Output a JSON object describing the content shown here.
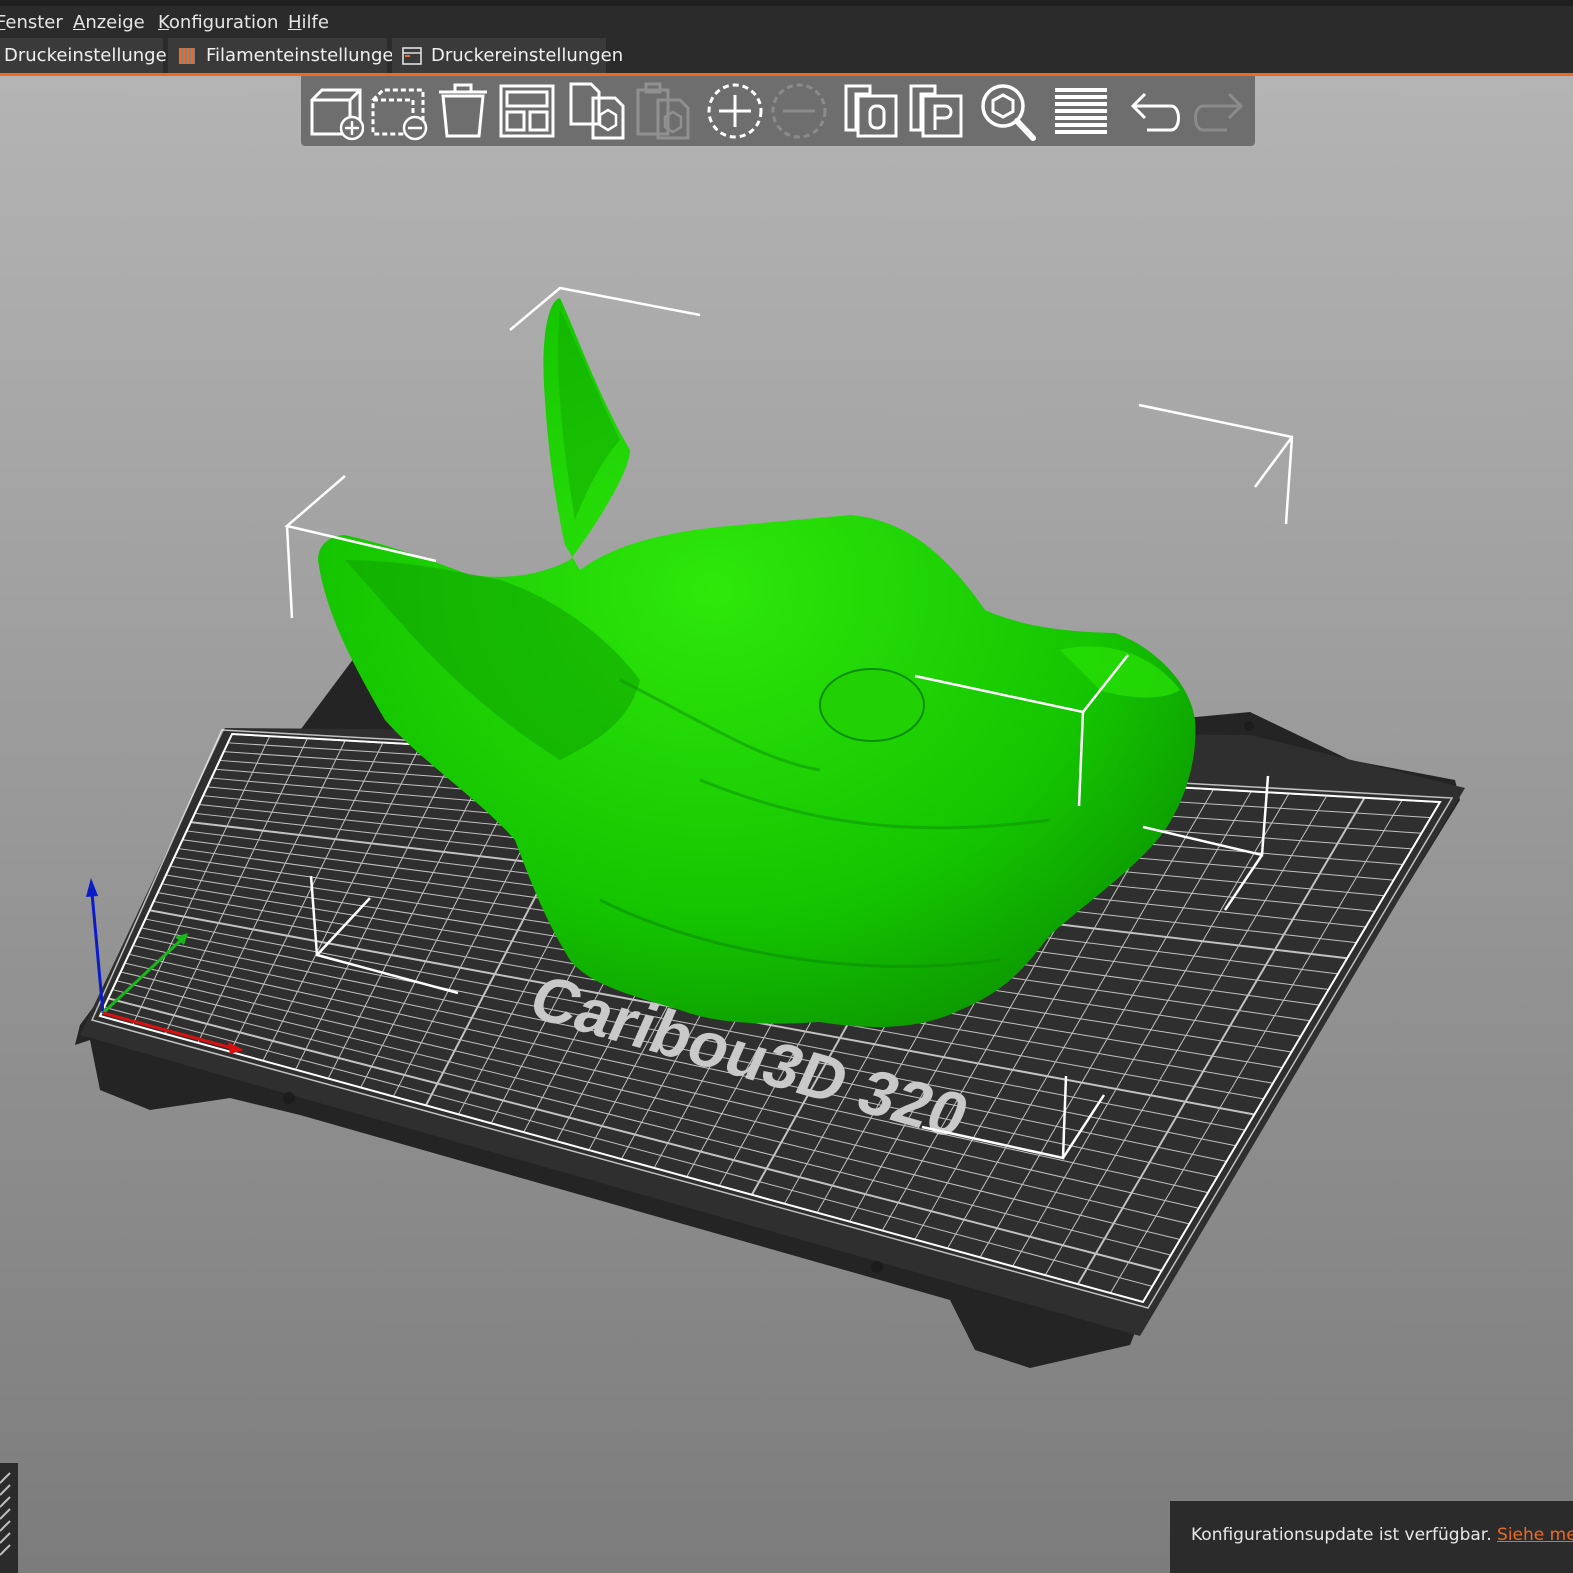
{
  "menu": {
    "items": [
      {
        "prefix": "",
        "underline": "F",
        "rest": "enster"
      },
      {
        "prefix": "",
        "underline": "A",
        "rest": "nzeige"
      },
      {
        "prefix": "",
        "underline": "K",
        "rest": "onfiguration"
      },
      {
        "prefix": "",
        "underline": "H",
        "rest": "ilfe"
      }
    ]
  },
  "tabs": {
    "print_settings": "Druckeinstellungen",
    "filament_settings": "Filamenteinstellungen",
    "printer_settings": "Druckereinstellungen"
  },
  "toolbar": {
    "items": [
      {
        "name": "add",
        "icon": "add-cube-icon",
        "enabled": true
      },
      {
        "name": "delete",
        "icon": "delete-cube-icon",
        "enabled": true
      },
      {
        "name": "delete-all",
        "icon": "trash-icon",
        "enabled": true
      },
      {
        "name": "arrange",
        "icon": "arrange-icon",
        "enabled": true
      },
      {
        "name": "copy",
        "icon": "copy-icon",
        "enabled": true
      },
      {
        "name": "paste",
        "icon": "paste-icon",
        "enabled": false
      },
      {
        "name": "add-instance",
        "icon": "plus-circle-icon",
        "enabled": true
      },
      {
        "name": "remove-instance",
        "icon": "minus-circle-icon",
        "enabled": false
      },
      {
        "name": "split-objects",
        "icon": "split-objects-icon",
        "enabled": true
      },
      {
        "name": "split-parts",
        "icon": "split-parts-icon",
        "enabled": true
      },
      {
        "name": "search",
        "icon": "search-icon",
        "enabled": true
      },
      {
        "name": "layers",
        "icon": "layers-icon",
        "enabled": true
      },
      {
        "name": "undo",
        "icon": "undo-icon",
        "enabled": true
      },
      {
        "name": "redo",
        "icon": "redo-icon",
        "enabled": false
      }
    ]
  },
  "bed": {
    "label": "Caribou3D 320"
  },
  "colors": {
    "accent": "#ed6b21",
    "model": "#1ed900",
    "bed": "#2f2f2f",
    "grid": "#ffffff"
  },
  "notification": {
    "text": "Konfigurationsupdate ist verfügbar.",
    "link": "Siehe mehr."
  }
}
